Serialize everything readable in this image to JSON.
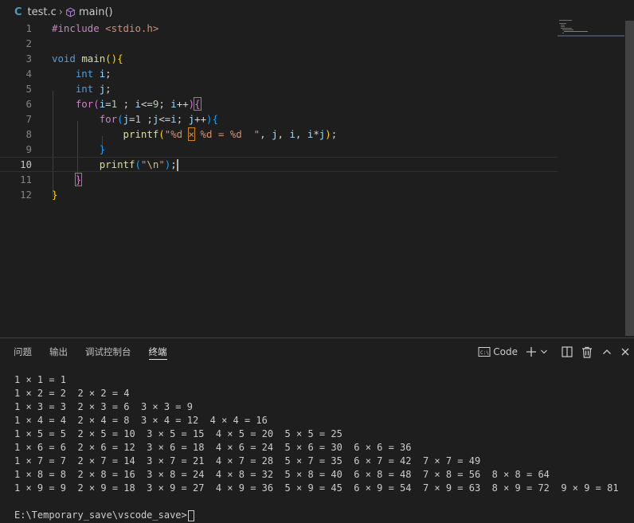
{
  "breadcrumb": {
    "lang_icon": "C",
    "file": "test.c",
    "symbol": "main()",
    "symbol_icon": "cube-icon"
  },
  "editor": {
    "current_line": 10,
    "lines": [
      {
        "no": "1",
        "tokens": [
          [
            "kw-pp",
            "#include "
          ],
          [
            "str",
            "<stdio.h>"
          ]
        ]
      },
      {
        "no": "2",
        "tokens": []
      },
      {
        "no": "3",
        "tokens": [
          [
            "kw-type",
            "void "
          ],
          [
            "fn",
            "main"
          ],
          [
            "br1",
            "()"
          ],
          [
            "br1",
            "{"
          ]
        ]
      },
      {
        "no": "4",
        "tokens": [
          [
            "op",
            "    "
          ],
          [
            "kw-type",
            "int "
          ],
          [
            "var",
            "i"
          ],
          [
            "op",
            ";"
          ]
        ]
      },
      {
        "no": "5",
        "tokens": [
          [
            "op",
            "    "
          ],
          [
            "kw-type",
            "int "
          ],
          [
            "var",
            "j"
          ],
          [
            "op",
            ";"
          ]
        ]
      },
      {
        "no": "6",
        "tokens": [
          [
            "op",
            "    "
          ],
          [
            "kw-ctl",
            "for"
          ],
          [
            "br2",
            "("
          ],
          [
            "var",
            "i"
          ],
          [
            "op",
            "="
          ],
          [
            "num",
            "1"
          ],
          [
            "op",
            " ; "
          ],
          [
            "var",
            "i"
          ],
          [
            "op",
            "<="
          ],
          [
            "num",
            "9"
          ],
          [
            "op",
            "; "
          ],
          [
            "var",
            "i"
          ],
          [
            "op",
            "++"
          ],
          [
            "br2",
            ")"
          ],
          [
            "br2 bracket-match",
            "{"
          ]
        ]
      },
      {
        "no": "7",
        "tokens": [
          [
            "op",
            "        "
          ],
          [
            "kw-ctl",
            "for"
          ],
          [
            "br3",
            "("
          ],
          [
            "var",
            "j"
          ],
          [
            "op",
            "="
          ],
          [
            "num",
            "1"
          ],
          [
            "op",
            " ;"
          ],
          [
            "var",
            "j"
          ],
          [
            "op",
            "<="
          ],
          [
            "var",
            "i"
          ],
          [
            "op",
            "; "
          ],
          [
            "var",
            "j"
          ],
          [
            "op",
            "++"
          ],
          [
            "br3",
            ")"
          ],
          [
            "br3",
            "{"
          ]
        ]
      },
      {
        "no": "8",
        "tokens": [
          [
            "op",
            "            "
          ],
          [
            "fn",
            "printf"
          ],
          [
            "br1",
            "("
          ],
          [
            "str",
            "\"%d "
          ],
          [
            "str unicode-hl",
            "×"
          ],
          [
            "str",
            " %d = %d  \""
          ],
          [
            "op",
            ", "
          ],
          [
            "var",
            "j"
          ],
          [
            "op",
            ", "
          ],
          [
            "var",
            "i"
          ],
          [
            "op",
            ", "
          ],
          [
            "var",
            "i"
          ],
          [
            "op",
            "*"
          ],
          [
            "var",
            "j"
          ],
          [
            "br1",
            ")"
          ],
          [
            "op",
            ";"
          ]
        ]
      },
      {
        "no": "9",
        "tokens": [
          [
            "op",
            "        "
          ],
          [
            "br3",
            "}"
          ]
        ]
      },
      {
        "no": "10",
        "tokens": [
          [
            "op",
            "        "
          ],
          [
            "fn",
            "printf"
          ],
          [
            "br3",
            "("
          ],
          [
            "str",
            "\""
          ],
          [
            "esc",
            "\\n"
          ],
          [
            "str",
            "\""
          ],
          [
            "br3",
            ")"
          ],
          [
            "op",
            ";"
          ]
        ]
      },
      {
        "no": "11",
        "tokens": [
          [
            "op",
            "    "
          ],
          [
            "br2 bracket-match",
            "}"
          ]
        ]
      },
      {
        "no": "12",
        "tokens": [
          [
            "br1",
            "}"
          ]
        ]
      }
    ]
  },
  "panel": {
    "tabs": [
      {
        "label": "问题",
        "active": false
      },
      {
        "label": "输出",
        "active": false
      },
      {
        "label": "调试控制台",
        "active": false
      },
      {
        "label": "终端",
        "active": true
      }
    ],
    "profile_label": "Code",
    "actions": [
      "add-terminal-icon",
      "chevron-down-icon",
      "split-terminal-icon",
      "trash-icon",
      "maximize-panel-icon",
      "close-panel-icon"
    ]
  },
  "terminal": {
    "lines": [
      "1 × 1 = 1",
      "1 × 2 = 2  2 × 2 = 4",
      "1 × 3 = 3  2 × 3 = 6  3 × 3 = 9",
      "1 × 4 = 4  2 × 4 = 8  3 × 4 = 12  4 × 4 = 16",
      "1 × 5 = 5  2 × 5 = 10  3 × 5 = 15  4 × 5 = 20  5 × 5 = 25",
      "1 × 6 = 6  2 × 6 = 12  3 × 6 = 18  4 × 6 = 24  5 × 6 = 30  6 × 6 = 36",
      "1 × 7 = 7  2 × 7 = 14  3 × 7 = 21  4 × 7 = 28  5 × 7 = 35  6 × 7 = 42  7 × 7 = 49",
      "1 × 8 = 8  2 × 8 = 16  3 × 8 = 24  4 × 8 = 32  5 × 8 = 40  6 × 8 = 48  7 × 8 = 56  8 × 8 = 64",
      "1 × 9 = 9  2 × 9 = 18  3 × 9 = 27  4 × 9 = 36  5 × 9 = 45  6 × 9 = 54  7 × 9 = 63  8 × 9 = 72  9 × 9 = 81",
      ""
    ],
    "prompt": "E:\\Temporary_save\\vscode_save>"
  }
}
